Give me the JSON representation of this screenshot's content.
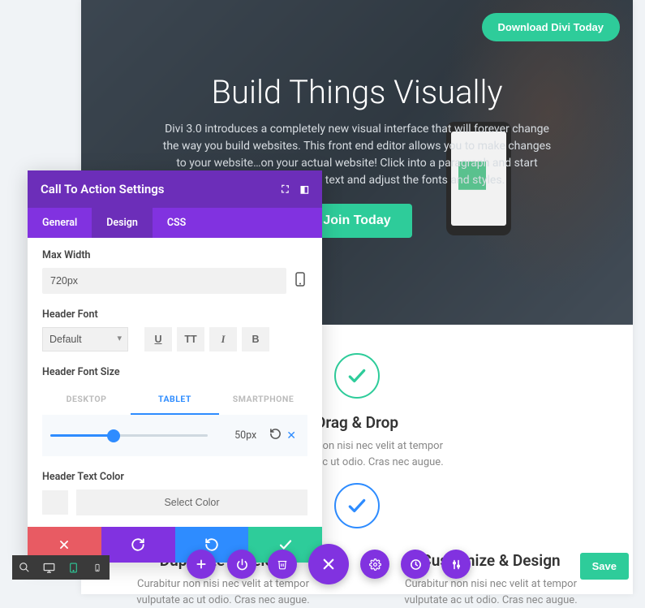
{
  "hero": {
    "title": "Build Things Visually",
    "description": "Divi 3.0 introduces a completely new visual interface that will forever change the way you build websites. This front end editor allows you to make changes to your website…on your actual website! Click into a paragraph and start typing. Highlight some text and adjust the fonts and styles.",
    "cta_label": "Join Today",
    "download_label": "Download Divi Today"
  },
  "features": [
    {
      "title": "Drag & Drop",
      "desc": "Curabitur non nisi nec velit at tempor vulputate ac ut odio. Cras nec augue.",
      "icon": "check",
      "color": "#2ecc9a"
    },
    {
      "title": "Duplicate & Delete",
      "desc": "Curabitur non nisi nec velit at tempor vulputate ac ut odio. Cras nec augue.",
      "icon": "check",
      "color": "#2e8cff"
    },
    {
      "title": "Customize & Design",
      "desc": "Curabitur non nisi nec velit at tempor vulputate ac ut odio. Cras nec augue.",
      "icon": "check",
      "color": "#2e8cff"
    }
  ],
  "panel": {
    "title": "Call To Action Settings",
    "tabs": {
      "general": "General",
      "design": "Design",
      "css": "CSS"
    },
    "active_tab": "design",
    "max_width_label": "Max Width",
    "max_width_value": "720px",
    "header_font_label": "Header Font",
    "header_font_value": "Default",
    "font_buttons": {
      "underline": "U",
      "uppercase": "TT",
      "italic": "I",
      "bold": "B"
    },
    "header_font_size_label": "Header Font Size",
    "device_tabs": {
      "desktop": "DESKTOP",
      "tablet": "TABLET",
      "smartphone": "SMARTPHONE"
    },
    "active_device": "tablet",
    "slider_value": "50px",
    "header_text_color_label": "Header Text Color",
    "select_color_label": "Select Color"
  },
  "bottom_actions": {
    "save_label": "Save"
  }
}
